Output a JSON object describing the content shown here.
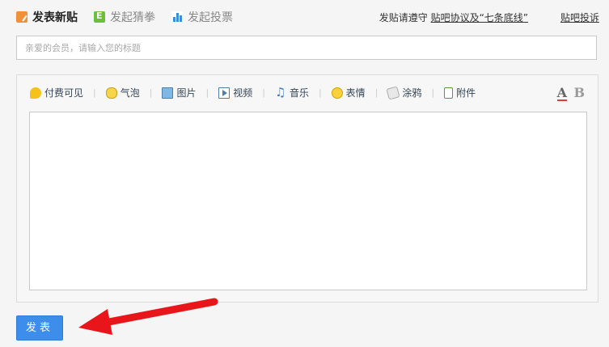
{
  "tabs": [
    {
      "label": "发表新贴",
      "icon": "post-icon",
      "active": true
    },
    {
      "label": "发起猜拳",
      "icon": "guess-icon",
      "active": false
    },
    {
      "label": "发起投票",
      "icon": "vote-icon",
      "active": false
    }
  ],
  "rules": {
    "prefix": "发贴请遵守 ",
    "agreement": "贴吧协议及“七条底线”",
    "report": "贴吧投诉"
  },
  "title_input": {
    "placeholder": "亲爱的会员，请输入您的标题",
    "value": ""
  },
  "toolbar": {
    "items": [
      {
        "label": "付费可见",
        "icon": "pay-icon"
      },
      {
        "label": "气泡",
        "icon": "bubble-icon"
      },
      {
        "label": "图片",
        "icon": "image-icon"
      },
      {
        "label": "视频",
        "icon": "video-icon"
      },
      {
        "label": "音乐",
        "icon": "music-icon"
      },
      {
        "label": "表情",
        "icon": "emoji-icon"
      },
      {
        "label": "涂鸦",
        "icon": "doodle-icon"
      },
      {
        "label": "附件",
        "icon": "attachment-icon"
      }
    ],
    "separator": "|",
    "font_color_label": "A",
    "bold_label": "B"
  },
  "submit": {
    "label": "发表"
  },
  "colors": {
    "accent": "#3d8eea",
    "arrow": "#e8161b"
  }
}
